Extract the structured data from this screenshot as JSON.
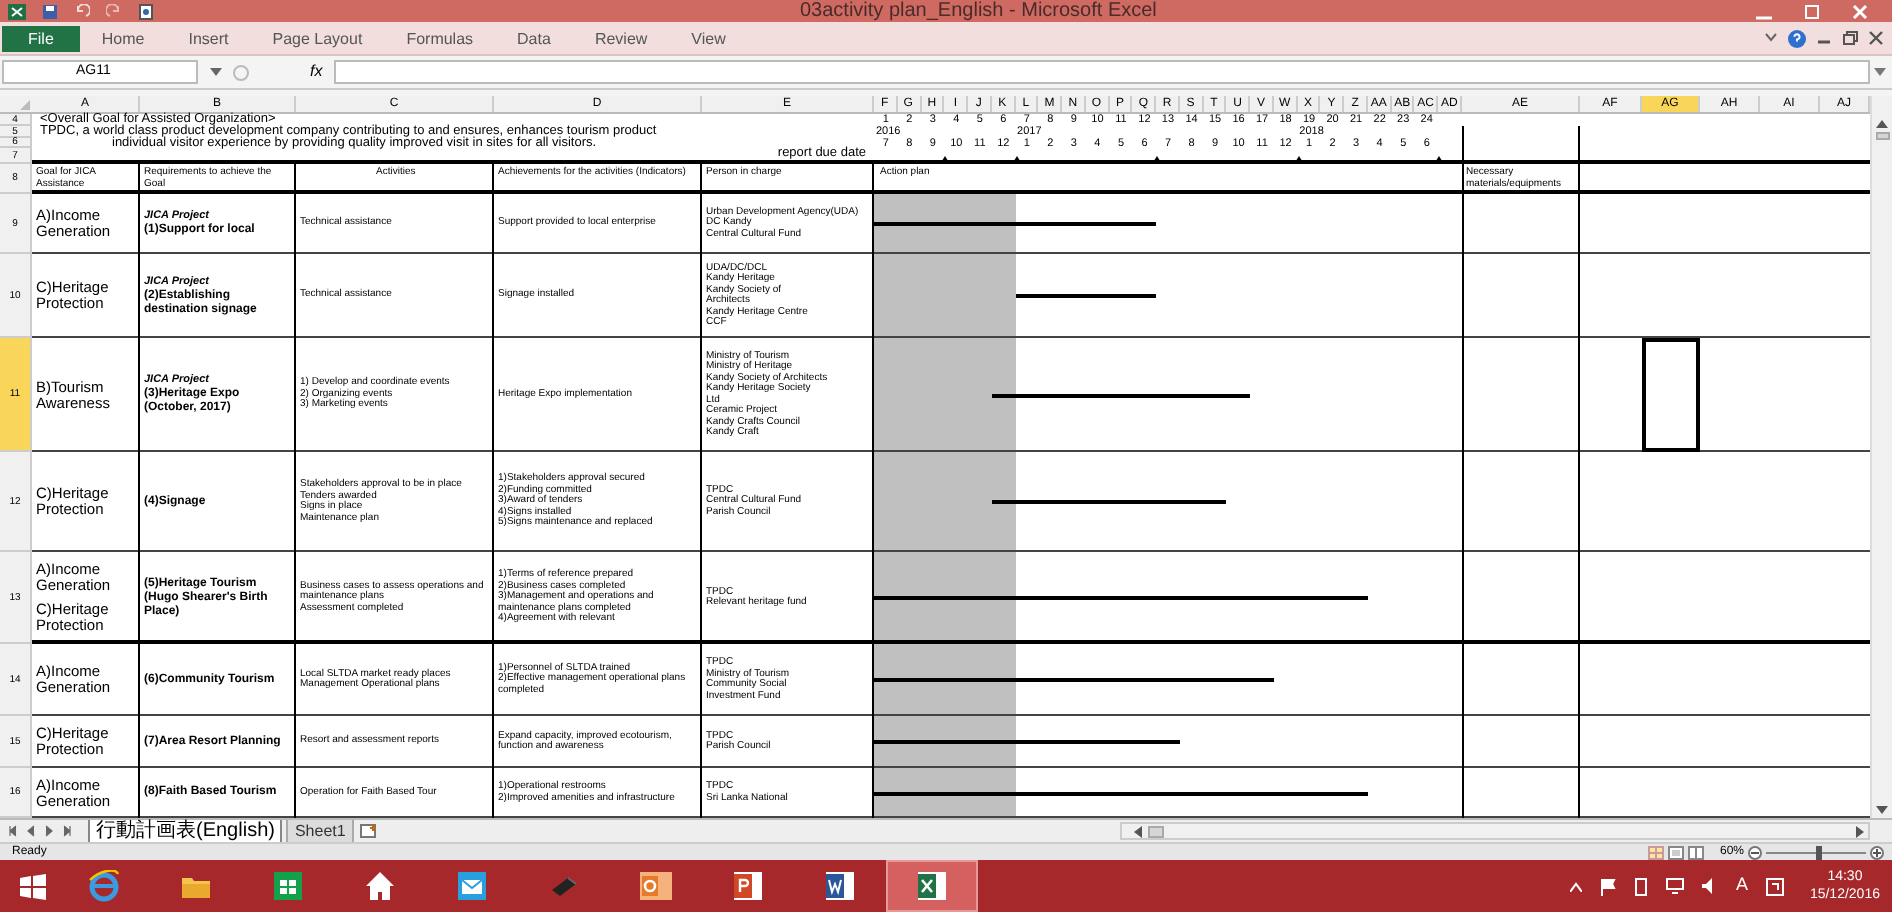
{
  "window": {
    "title": "03activity plan_English - Microsoft Excel"
  },
  "ribbon_tabs": [
    {
      "label": "File",
      "kind": "file",
      "selected": false
    },
    {
      "label": "Home",
      "kind": "tab",
      "selected": false
    },
    {
      "label": "Insert",
      "kind": "tab",
      "selected": false
    },
    {
      "label": "Page Layout",
      "kind": "tab",
      "selected": false
    },
    {
      "label": "Formulas",
      "kind": "tab",
      "selected": false
    },
    {
      "label": "Data",
      "kind": "tab",
      "selected": false
    },
    {
      "label": "Review",
      "kind": "tab",
      "selected": false
    },
    {
      "label": "View",
      "kind": "tab",
      "selected": false
    }
  ],
  "formula_bar": {
    "name_box": "AG11",
    "fx": "fx"
  },
  "columns": [
    {
      "label": "A",
      "selected": false
    },
    {
      "label": "B",
      "selected": false
    },
    {
      "label": "C",
      "selected": false
    },
    {
      "label": "D",
      "selected": false
    },
    {
      "label": "E",
      "selected": false
    },
    {
      "label": "F",
      "selected": false
    },
    {
      "label": "G",
      "selected": false
    },
    {
      "label": "H",
      "selected": false
    },
    {
      "label": "I",
      "selected": false
    },
    {
      "label": "J",
      "selected": false
    },
    {
      "label": "K",
      "selected": false
    },
    {
      "label": "L",
      "selected": false
    },
    {
      "label": "M",
      "selected": false
    },
    {
      "label": "N",
      "selected": false
    },
    {
      "label": "O",
      "selected": false
    },
    {
      "label": "P",
      "selected": false
    },
    {
      "label": "Q",
      "selected": false
    },
    {
      "label": "R",
      "selected": false
    },
    {
      "label": "S",
      "selected": false
    },
    {
      "label": "T",
      "selected": false
    },
    {
      "label": "U",
      "selected": false
    },
    {
      "label": "V",
      "selected": false
    },
    {
      "label": "W",
      "selected": false
    },
    {
      "label": "X",
      "selected": false
    },
    {
      "label": "Y",
      "selected": false
    },
    {
      "label": "Z",
      "selected": false
    },
    {
      "label": "AA",
      "selected": false
    },
    {
      "label": "AB",
      "selected": false
    },
    {
      "label": "AC",
      "selected": false
    },
    {
      "label": "AD",
      "selected": false
    },
    {
      "label": "AE",
      "selected": false
    },
    {
      "label": "AF",
      "selected": false
    },
    {
      "label": "AG",
      "selected": true
    },
    {
      "label": "AH",
      "selected": false
    },
    {
      "label": "AI",
      "selected": false
    },
    {
      "label": "AJ",
      "selected": false
    }
  ],
  "top_rows": [
    {
      "number": "4",
      "selected": false,
      "text": "<Overall Goal for Assisted Organization>"
    },
    {
      "number": "5",
      "selected": false,
      "text": "TPDC, a world class product development company contributing to and ensures, enhances tourism product"
    },
    {
      "number": "6",
      "selected": false,
      "text": "individual visitor experience by providing quality improved visit in sites for all visitors."
    },
    {
      "number": "7",
      "selected": false,
      "text": "report due date"
    }
  ],
  "months": [
    {
      "index": "1",
      "year": "2016",
      "month": "7",
      "shaded": true,
      "report_due": false
    },
    {
      "index": "2",
      "month": "8",
      "shaded": true,
      "report_due": false
    },
    {
      "index": "3",
      "month": "9",
      "shaded": true,
      "report_due": true
    },
    {
      "index": "4",
      "month": "10",
      "shaded": true,
      "report_due": false
    },
    {
      "index": "5",
      "month": "11",
      "shaded": true,
      "report_due": false
    },
    {
      "index": "6",
      "month": "12",
      "shaded": true,
      "report_due": true
    },
    {
      "index": "7",
      "year": "2017",
      "month": "1",
      "shaded": false,
      "report_due": false
    },
    {
      "index": "8",
      "month": "2",
      "shaded": false,
      "report_due": false
    },
    {
      "index": "9",
      "month": "3",
      "shaded": false,
      "report_due": false
    },
    {
      "index": "10",
      "month": "4",
      "shaded": false,
      "report_due": false
    },
    {
      "index": "11",
      "month": "5",
      "shaded": false,
      "report_due": false
    },
    {
      "index": "12",
      "month": "6",
      "shaded": false,
      "report_due": true
    },
    {
      "index": "13",
      "month": "7",
      "shaded": false,
      "report_due": false
    },
    {
      "index": "14",
      "month": "8",
      "shaded": false,
      "report_due": false
    },
    {
      "index": "15",
      "month": "9",
      "shaded": false,
      "report_due": false
    },
    {
      "index": "16",
      "month": "10",
      "shaded": false,
      "report_due": false
    },
    {
      "index": "17",
      "month": "11",
      "shaded": false,
      "report_due": false
    },
    {
      "index": "18",
      "month": "12",
      "shaded": false,
      "report_due": true
    },
    {
      "index": "19",
      "year": "2018",
      "month": "1",
      "shaded": false,
      "report_due": false
    },
    {
      "index": "20",
      "month": "2",
      "shaded": false,
      "report_due": false
    },
    {
      "index": "21",
      "month": "3",
      "shaded": false,
      "report_due": false
    },
    {
      "index": "22",
      "month": "4",
      "shaded": false,
      "report_due": false
    },
    {
      "index": "23",
      "month": "5",
      "shaded": false,
      "report_due": false
    },
    {
      "index": "24",
      "month": "6",
      "shaded": false,
      "report_due": true
    }
  ],
  "header_row": {
    "number": "8",
    "selected": false,
    "goal": "Goal for JICA Assistance",
    "requirements": "Requirements to achieve the Goal",
    "activities": "Activities",
    "achievements": "Achievements for the activities (Indicators)",
    "person": "Person in charge",
    "action_plan": "Action plan",
    "materials": "Necessary materials/equipments"
  },
  "rows": [
    {
      "number": "9",
      "selected": false,
      "goal": [
        "A)Income Generation"
      ],
      "program": "JICA Project",
      "requirement": "(1)Support for local",
      "activities": [
        "Technical assistance"
      ],
      "achievements": [
        "Support provided to local enterprise"
      ],
      "person": [
        "Urban Development Agency(UDA)",
        "DC Kandy",
        "Central Cultural Fund"
      ],
      "active_months": [
        true,
        true,
        true,
        true,
        true,
        true,
        true,
        true,
        true,
        true,
        true,
        true,
        false,
        false,
        false,
        false,
        false,
        false,
        false,
        false,
        false,
        false,
        false,
        false
      ]
    },
    {
      "number": "10",
      "selected": false,
      "goal": [
        "C)Heritage Protection"
      ],
      "program": "JICA Project",
      "requirement": "(2)Establishing destination signage",
      "activities": [
        "Technical assistance"
      ],
      "achievements": [
        "Signage installed"
      ],
      "person": [
        "UDA/DC/DCL",
        "Kandy Heritage",
        "Kandy Society of",
        "Architects",
        "Kandy Heritage Centre",
        "CCF"
      ],
      "active_months": [
        false,
        false,
        false,
        false,
        false,
        false,
        true,
        true,
        true,
        true,
        true,
        true,
        false,
        false,
        false,
        false,
        false,
        false,
        false,
        false,
        false,
        false,
        false,
        false
      ]
    },
    {
      "number": "11",
      "selected": true,
      "goal": [
        "B)Tourism Awareness"
      ],
      "program": "JICA Project",
      "requirement": "(3)Heritage Expo (October, 2017)",
      "activities": [
        "1) Develop and coordinate events",
        "2) Organizing events",
        "3) Marketing events"
      ],
      "achievements": [
        "Heritage Expo implementation"
      ],
      "person": [
        "Ministry of Tourism",
        "Ministry of Heritage",
        "Kandy Society of Architects",
        "Kandy Heritage Society",
        "Ltd",
        "Ceramic Project",
        "Kandy Crafts Council",
        "Kandy Craft"
      ],
      "active_months": [
        false,
        false,
        false,
        false,
        false,
        true,
        true,
        true,
        true,
        true,
        true,
        true,
        true,
        true,
        true,
        true,
        false,
        false,
        false,
        false,
        false,
        false,
        false,
        false
      ]
    },
    {
      "number": "12",
      "selected": false,
      "goal": [
        "C)Heritage Protection"
      ],
      "requirement": "(4)Signage",
      "activities": [
        "Stakeholders approval to be in place",
        "Tenders awarded",
        "Signs in place",
        "Maintenance plan"
      ],
      "achievements": [
        "1)Stakeholders approval secured",
        "2)Funding committed",
        "3)Award of tenders",
        "4)Signs installed",
        "5)Signs maintenance and replaced"
      ],
      "person": [
        "TPDC",
        "Central Cultural Fund",
        "Parish Council"
      ],
      "active_months": [
        false,
        false,
        false,
        false,
        false,
        true,
        true,
        true,
        true,
        true,
        true,
        true,
        true,
        true,
        true,
        false,
        false,
        false,
        false,
        false,
        false,
        false,
        false,
        false
      ]
    },
    {
      "number": "13",
      "selected": false,
      "goal": [
        "A)Income Generation",
        "C)Heritage Protection"
      ],
      "requirement": "(5)Heritage Tourism (Hugo Shearer's Birth Place)",
      "activities": [
        "Business cases to assess operations and maintenance plans",
        "Assessment completed"
      ],
      "achievements": [
        "1)Terms of reference prepared",
        "2)Business cases completed",
        "3)Management and operations and maintenance plans completed",
        "4)Agreement with relevant"
      ],
      "person": [
        "TPDC",
        "Relevant heritage fund"
      ],
      "active_months": [
        true,
        true,
        true,
        true,
        true,
        true,
        true,
        true,
        true,
        true,
        true,
        true,
        true,
        true,
        true,
        true,
        true,
        true,
        true,
        true,
        true,
        false,
        false,
        false
      ]
    },
    {
      "number": "14",
      "selected": false,
      "goal": [
        "A)Income Generation"
      ],
      "requirement": "(6)Community Tourism",
      "activities": [
        "Local SLTDA market ready places",
        "Management Operational plans"
      ],
      "achievements": [
        "1)Personnel of SLTDA trained",
        "2)Effective management operational plans completed"
      ],
      "person": [
        "TPDC",
        "Ministry of Tourism",
        "Community Social",
        "Investment Fund"
      ],
      "active_months": [
        true,
        true,
        true,
        true,
        true,
        true,
        true,
        true,
        true,
        true,
        true,
        true,
        true,
        true,
        true,
        true,
        true,
        false,
        false,
        false,
        false,
        false,
        false,
        false
      ]
    },
    {
      "number": "15",
      "selected": false,
      "goal": [
        "C)Heritage Protection"
      ],
      "requirement": "(7)Area Resort Planning",
      "activities": [
        "Resort and assessment reports"
      ],
      "achievements": [
        "Expand capacity, improved ecotourism, function and awareness"
      ],
      "person": [
        "TPDC",
        "Parish Council"
      ],
      "active_months": [
        true,
        true,
        true,
        true,
        true,
        true,
        true,
        true,
        true,
        true,
        true,
        true,
        true,
        false,
        false,
        false,
        false,
        false,
        false,
        false,
        false,
        false,
        false,
        false
      ]
    },
    {
      "number": "16",
      "selected": false,
      "goal": [
        "A)Income Generation"
      ],
      "requirement": "(8)Faith Based Tourism",
      "activities": [
        "Operation for Faith Based Tour"
      ],
      "achievements": [
        "1)Operational restrooms",
        "2)Improved amenities and infrastructure"
      ],
      "person": [
        "TPDC",
        "Sri Lanka National"
      ],
      "active_months": [
        true,
        true,
        true,
        true,
        true,
        true,
        true,
        true,
        true,
        true,
        true,
        true,
        true,
        true,
        true,
        true,
        true,
        true,
        true,
        true,
        true,
        false,
        false,
        false
      ]
    }
  ],
  "sheet_tabs": [
    {
      "label": "行動計画表(English)",
      "selected": true
    },
    {
      "label": "Sheet1",
      "selected": false
    }
  ],
  "status_bar": {
    "status": "Ready",
    "zoom": "60%",
    "zoom_slider": {
      "level": 0.5
    }
  },
  "taskbar": {
    "apps": [
      {
        "kind": "ie",
        "selected": false
      },
      {
        "kind": "folder",
        "selected": false
      },
      {
        "kind": "store",
        "selected": false
      },
      {
        "kind": "home",
        "selected": false
      },
      {
        "kind": "mail",
        "selected": false
      },
      {
        "kind": "pen",
        "selected": false
      },
      {
        "kind": "outlook",
        "selected": false
      },
      {
        "kind": "powerpoint",
        "selected": false
      },
      {
        "kind": "word",
        "selected": false
      },
      {
        "kind": "excel",
        "selected": true
      }
    ],
    "time": "14:30",
    "date": "15/12/2016",
    "tray_letter": "A"
  }
}
